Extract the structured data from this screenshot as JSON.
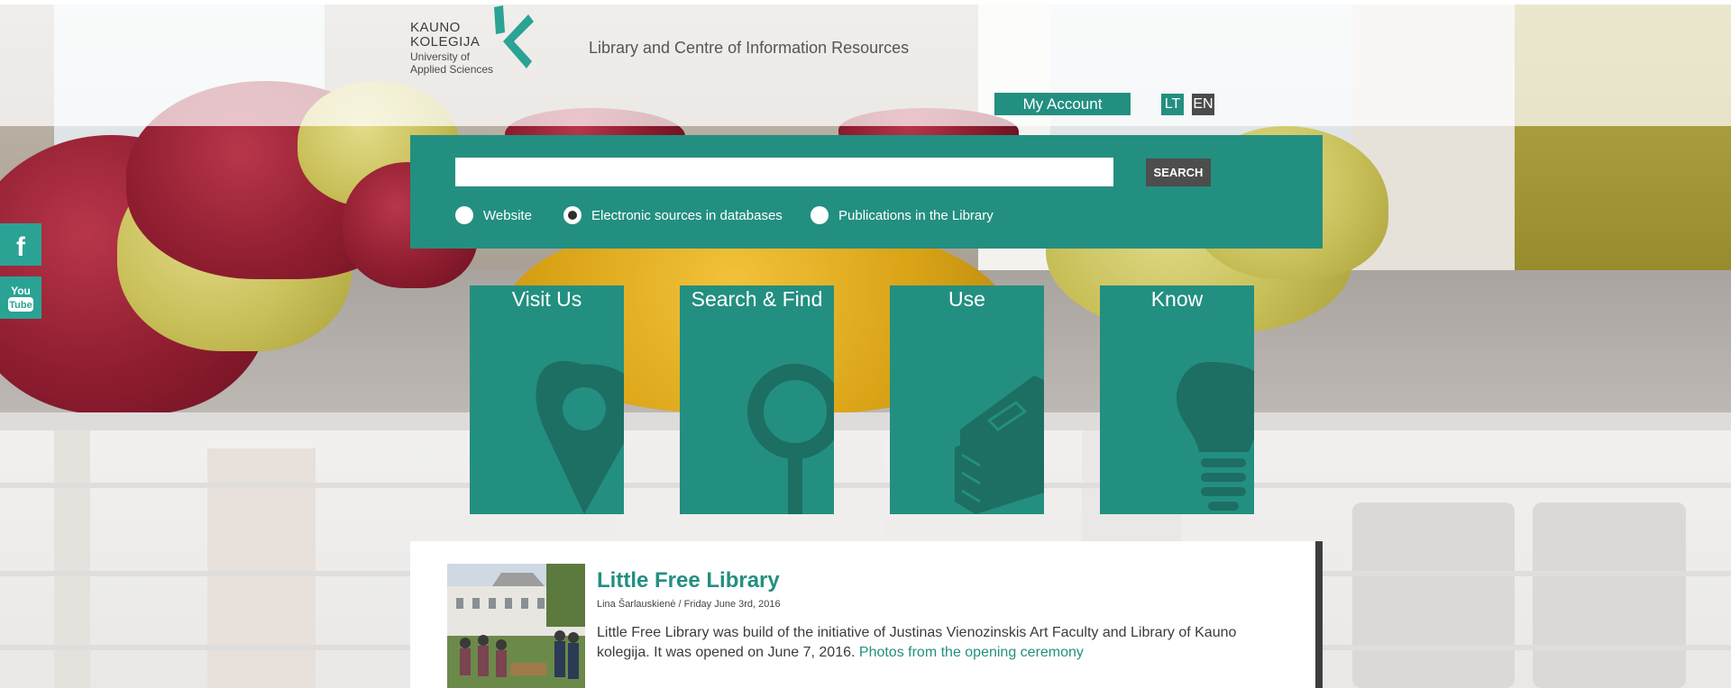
{
  "logo": {
    "line1": "KAUNO",
    "line2": "KOLEGIJA",
    "line3": "University of",
    "line4": "Applied Sciences"
  },
  "header": {
    "subtitle": "Library and Centre of Information Resources",
    "my_account": "My Account",
    "languages": [
      "LT",
      "EN"
    ]
  },
  "search": {
    "value": "",
    "button": "SEARCH",
    "options": [
      {
        "label": "Website",
        "checked": false
      },
      {
        "label": "Electronic sources in databases",
        "checked": true
      },
      {
        "label": "Publications in the Library",
        "checked": false
      }
    ]
  },
  "social": {
    "facebook": "f",
    "youtube_line1": "You",
    "youtube_line2": "Tube"
  },
  "tiles": [
    {
      "label": "Visit Us",
      "icon": "map-pin-icon"
    },
    {
      "label": "Search & Find",
      "icon": "magnifier-icon"
    },
    {
      "label": "Use",
      "icon": "book-stack-icon"
    },
    {
      "label": "Know",
      "icon": "light-bulb-icon"
    }
  ],
  "news": {
    "title": "Little Free Library",
    "meta": "Lina Šarlauskienė / Friday June 3rd, 2016",
    "body": "Little Free Library was build of the initiative of Justinas Vienozinskis Art Faculty and Library of Kauno kolegija. It was opened on June 7, 2016.",
    "link": "Photos from the opening ceremony"
  },
  "colors": {
    "accent": "#238f80",
    "dark_button": "#4b4b4b"
  }
}
